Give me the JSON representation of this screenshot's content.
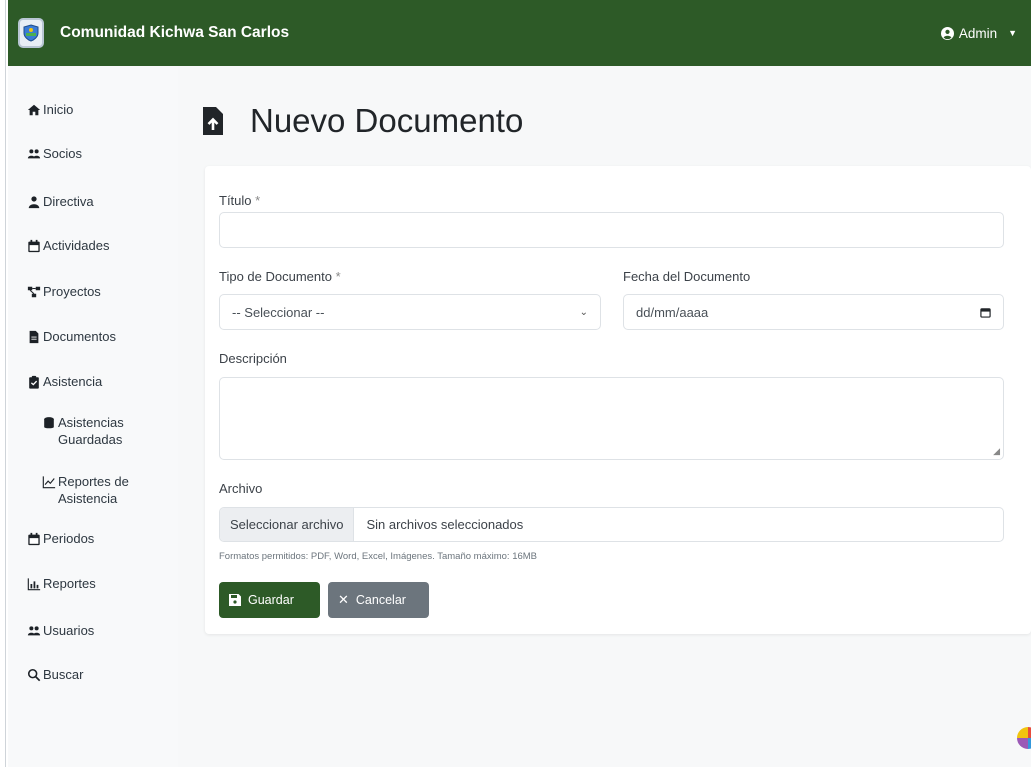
{
  "app": {
    "title": "Comunidad Kichwa San Carlos",
    "user": "Admin"
  },
  "colors": {
    "primary": "#2d5a27",
    "secondary": "#6c757d"
  },
  "sidebar": {
    "items": [
      {
        "label": "Inicio",
        "icon": "home-icon"
      },
      {
        "label": "Socios",
        "icon": "users-icon"
      },
      {
        "label": "Directiva",
        "icon": "user-tie-icon"
      },
      {
        "label": "Actividades",
        "icon": "calendar-icon"
      },
      {
        "label": "Proyectos",
        "icon": "project-diagram-icon"
      },
      {
        "label": "Documentos",
        "icon": "file-icon"
      },
      {
        "label": "Asistencia",
        "icon": "clipboard-check-icon"
      },
      {
        "label": "Asistencias Guardadas",
        "icon": "database-icon"
      },
      {
        "label": "Reportes de Asistencia",
        "icon": "chart-line-icon"
      },
      {
        "label": "Periodos",
        "icon": "calendar-icon"
      },
      {
        "label": "Reportes",
        "icon": "chart-bar-icon"
      },
      {
        "label": "Usuarios",
        "icon": "users-cog-icon"
      },
      {
        "label": "Buscar",
        "icon": "search-icon"
      }
    ]
  },
  "page": {
    "title": "Nuevo Documento",
    "icon": "file-upload-icon"
  },
  "form": {
    "titulo": {
      "label": "Título",
      "required": "*",
      "value": ""
    },
    "tipo": {
      "label": "Tipo de Documento",
      "required": "*",
      "selected": "-- Seleccionar --"
    },
    "fecha": {
      "label": "Fecha del Documento",
      "placeholder": "dd/mm/aaaa"
    },
    "descripcion": {
      "label": "Descripción",
      "value": ""
    },
    "archivo": {
      "label": "Archivo",
      "button": "Seleccionar archivo",
      "status": "Sin archivos seleccionados",
      "help": "Formatos permitidos: PDF, Word, Excel, Imágenes. Tamaño máximo: 16MB"
    },
    "actions": {
      "save": "Guardar",
      "cancel": "Cancelar"
    }
  }
}
